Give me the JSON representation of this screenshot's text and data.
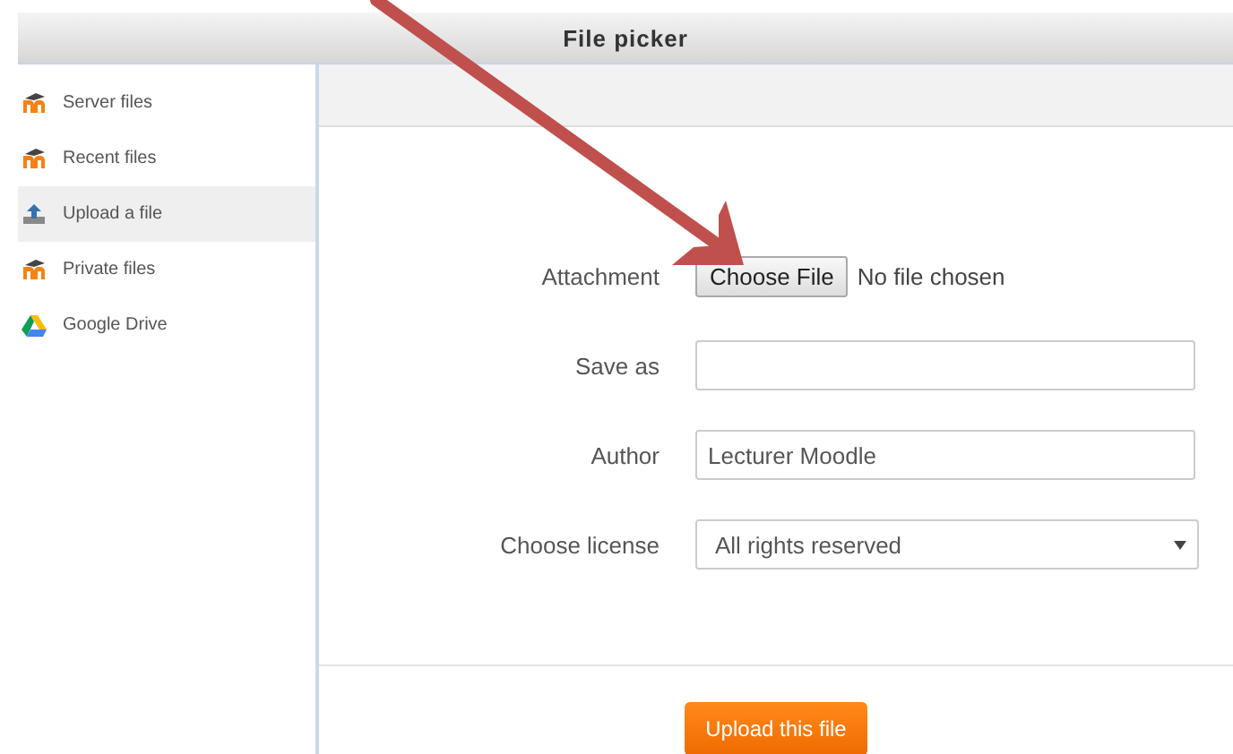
{
  "window": {
    "title": "File picker"
  },
  "sidebar": {
    "items": [
      {
        "label": "Server files",
        "kind": "moodle",
        "selected": false
      },
      {
        "label": "Recent files",
        "kind": "moodle",
        "selected": false
      },
      {
        "label": "Upload a file",
        "kind": "upload",
        "selected": true
      },
      {
        "label": "Private files",
        "kind": "moodle",
        "selected": false
      },
      {
        "label": "Google Drive",
        "kind": "drive",
        "selected": false
      }
    ]
  },
  "form": {
    "fields": [
      {
        "kind": "file",
        "label": "Attachment",
        "button": "Choose File",
        "status": "No file chosen"
      },
      {
        "kind": "text",
        "label": "Save as"
      },
      {
        "kind": "text",
        "label": "Author",
        "value": "Lecturer Moodle"
      },
      {
        "kind": "select",
        "label": "Choose license",
        "value": "All rights reserved"
      }
    ]
  },
  "upload_button": "Upload this file"
}
